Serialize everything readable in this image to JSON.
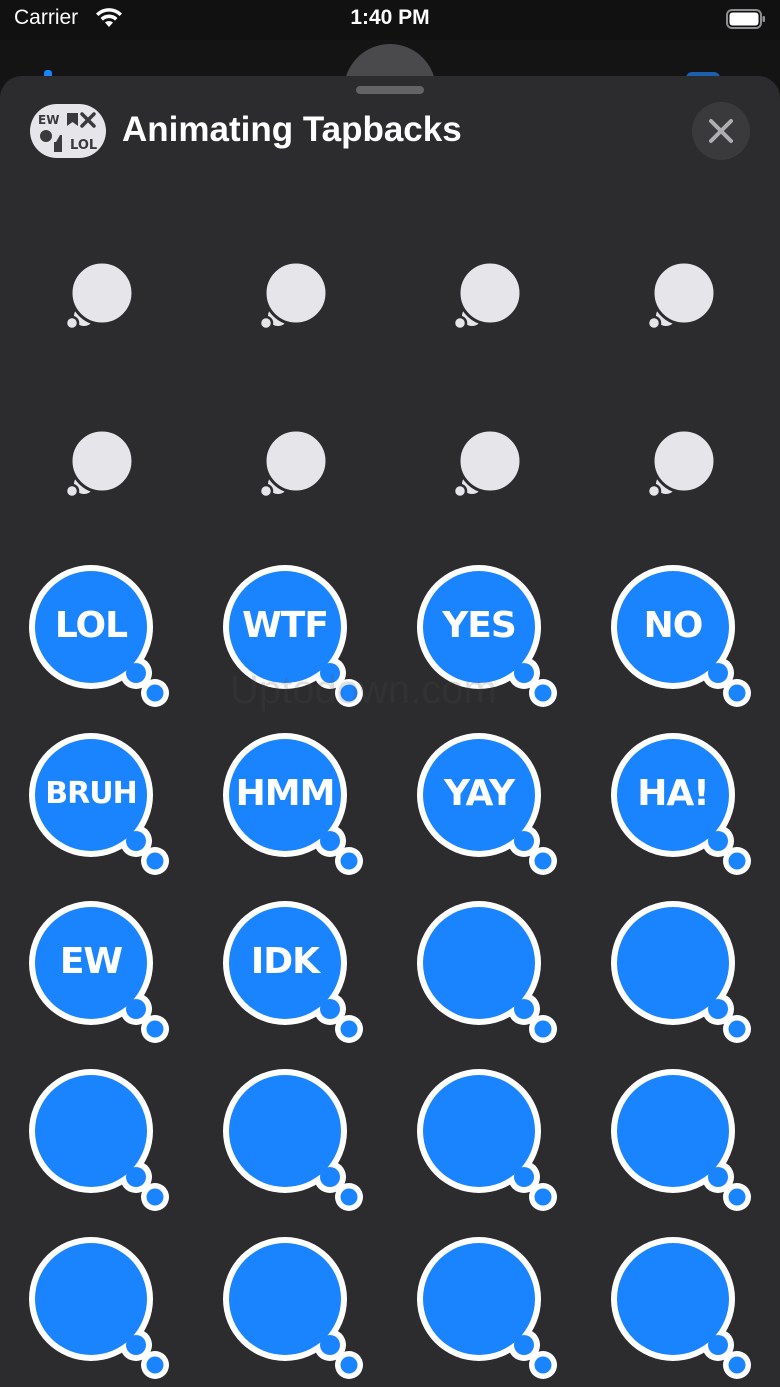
{
  "status_bar": {
    "carrier": "Carrier",
    "time": "1:40 PM"
  },
  "sheet": {
    "title": "Animating Tapbacks",
    "app_icon_text": [
      "EW",
      "LOL"
    ],
    "close_icon": "close-icon"
  },
  "watermark": "Uptodown.com",
  "stickers": [
    {
      "label": "",
      "style": "gray"
    },
    {
      "label": "",
      "style": "gray"
    },
    {
      "label": "",
      "style": "gray"
    },
    {
      "label": "",
      "style": "gray"
    },
    {
      "label": "",
      "style": "gray"
    },
    {
      "label": "",
      "style": "gray"
    },
    {
      "label": "",
      "style": "gray"
    },
    {
      "label": "",
      "style": "gray"
    },
    {
      "label": "LOL",
      "style": "blue"
    },
    {
      "label": "WTF",
      "style": "blue"
    },
    {
      "label": "YES",
      "style": "blue"
    },
    {
      "label": "NO",
      "style": "blue"
    },
    {
      "label": "BRUH",
      "style": "blue"
    },
    {
      "label": "HMM",
      "style": "blue"
    },
    {
      "label": "YAY",
      "style": "blue"
    },
    {
      "label": "HA!",
      "style": "blue"
    },
    {
      "label": "EW",
      "style": "blue"
    },
    {
      "label": "IDK",
      "style": "blue"
    },
    {
      "label": "",
      "style": "blue"
    },
    {
      "label": "",
      "style": "blue"
    },
    {
      "label": "",
      "style": "blue"
    },
    {
      "label": "",
      "style": "blue"
    },
    {
      "label": "",
      "style": "blue"
    },
    {
      "label": "",
      "style": "blue"
    },
    {
      "label": "",
      "style": "blue"
    },
    {
      "label": "",
      "style": "blue"
    },
    {
      "label": "",
      "style": "blue"
    },
    {
      "label": "",
      "style": "blue"
    }
  ],
  "colors": {
    "sheet_background": "#2c2c2e",
    "bubble_blue": "#1a84ff",
    "bubble_gray": "#e5e5ea",
    "bubble_outline": "#ffffff"
  }
}
